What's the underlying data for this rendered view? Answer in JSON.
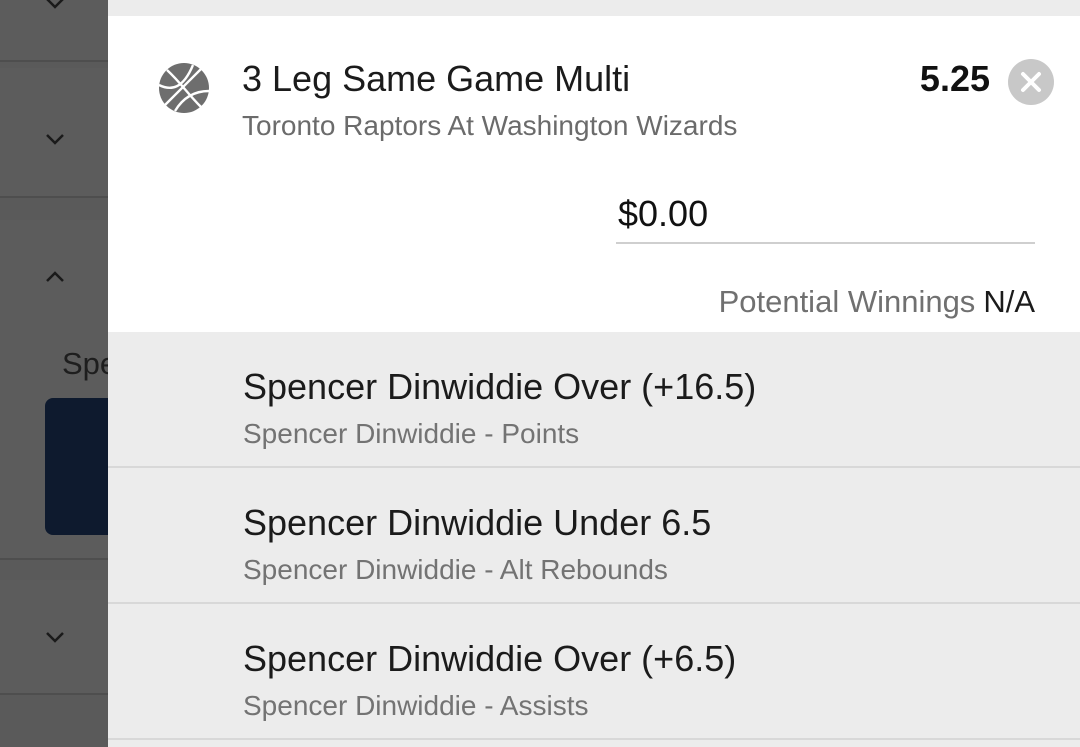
{
  "background": {
    "partial_text": "Spe",
    "chevrons": [
      "chevron-down",
      "chevron-down",
      "chevron-up",
      "chevron-down"
    ]
  },
  "betslip": {
    "sport_icon": "basketball-icon",
    "title": "3 Leg Same Game Multi",
    "event": "Toronto Raptors At Washington Wizards",
    "odds": "5.25",
    "close_icon": "close-icon",
    "stake_value": "$0.00",
    "potential_winnings_label": "Potential Winnings",
    "potential_winnings_value": "N/A",
    "legs": [
      {
        "selection": "Spencer Dinwiddie Over (+16.5)",
        "market": "Spencer Dinwiddie - Points"
      },
      {
        "selection": "Spencer Dinwiddie Under 6.5",
        "market": "Spencer Dinwiddie - Alt Rebounds"
      },
      {
        "selection": "Spencer Dinwiddie Over (+6.5)",
        "market": "Spencer Dinwiddie - Assists"
      }
    ]
  },
  "colors": {
    "overlay_dim": "#5a5a5a",
    "panel_bg": "#ececec",
    "card_bg": "#ffffff",
    "close_button": "#c8c8c8",
    "dark_block": "#0e1a2e"
  }
}
